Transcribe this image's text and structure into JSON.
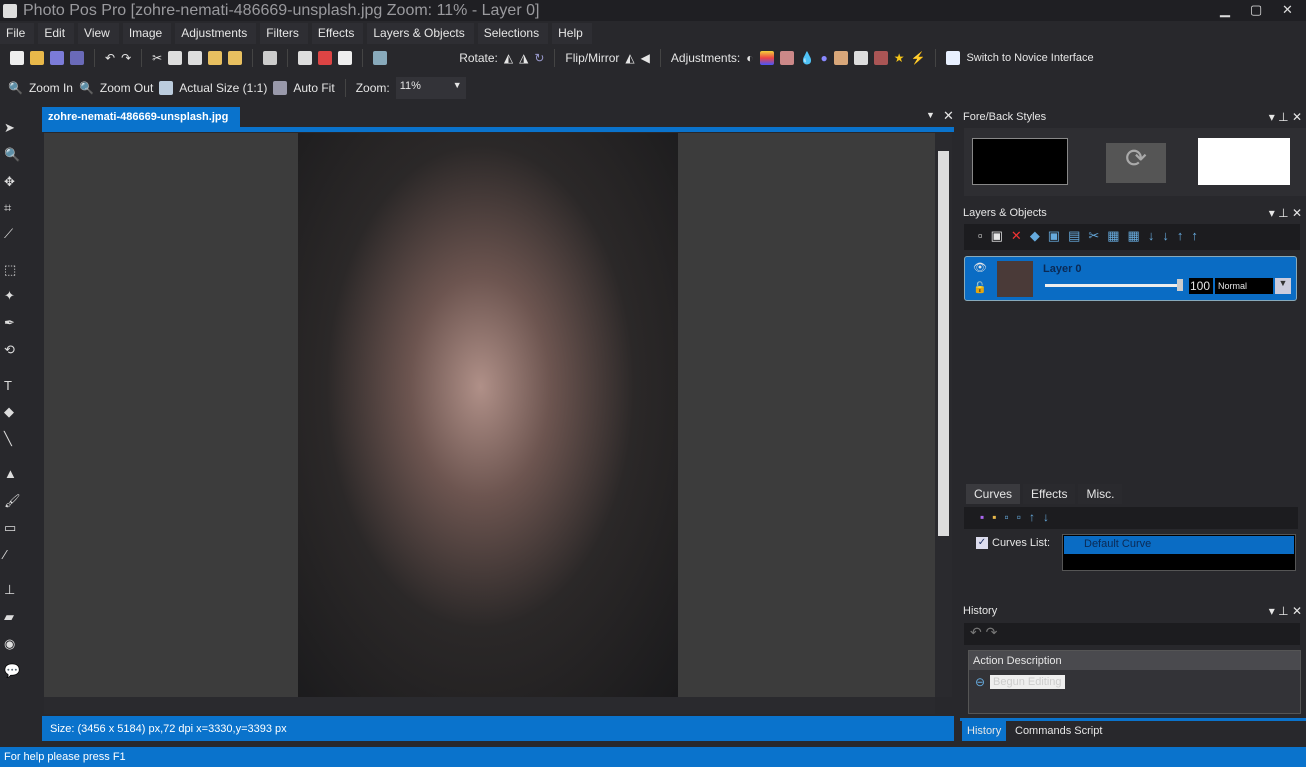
{
  "window": {
    "title": "Photo Pos Pro [zohre-nemati-486669-unsplash.jpg Zoom: 11% - Layer 0]",
    "minimize": "▁",
    "maximize": "▢",
    "close": "✕"
  },
  "menu": [
    "File",
    "Edit",
    "View",
    "Image",
    "Adjustments",
    "Filters",
    "Effects",
    "Layers & Objects",
    "Selections",
    "Help"
  ],
  "toolbar": {
    "rotate_label": "Rotate:",
    "flip_label": "Flip/Mirror",
    "adjust_label": "Adjustments:",
    "novice_label": "Switch to Novice Interface"
  },
  "toolbar2": {
    "zoom_in": "Zoom In",
    "zoom_out": "Zoom Out",
    "actual_size": "Actual Size (1:1)",
    "auto_fit": "Auto Fit",
    "zoom_label": "Zoom:",
    "zoom_value": "11%"
  },
  "document": {
    "tab": "zohre-nemati-486669-unsplash.jpg",
    "status": "Size: (3456 x 5184) px,72 dpi   x=3330,y=3393 px"
  },
  "panels": {
    "fore_back": {
      "title": "Fore/Back Styles",
      "fore_color": "#000000",
      "back_color": "#ffffff"
    },
    "layers": {
      "title": "Layers & Objects",
      "layer_name": "Layer 0",
      "opacity": "100",
      "opacity_value": 100,
      "blend": "Normal"
    },
    "tabs": [
      "Curves",
      "Effects",
      "Misc."
    ],
    "curves": {
      "list_label": "Curves List:",
      "item": "Default Curve"
    },
    "history": {
      "title": "History",
      "column": "Action Description",
      "item": "Begun Editing"
    },
    "bottom_tabs": [
      "History",
      "Commands Script"
    ]
  },
  "status": "For help please press F1",
  "colors": {
    "accent": "#0a73cc",
    "bg": "#28282c"
  }
}
